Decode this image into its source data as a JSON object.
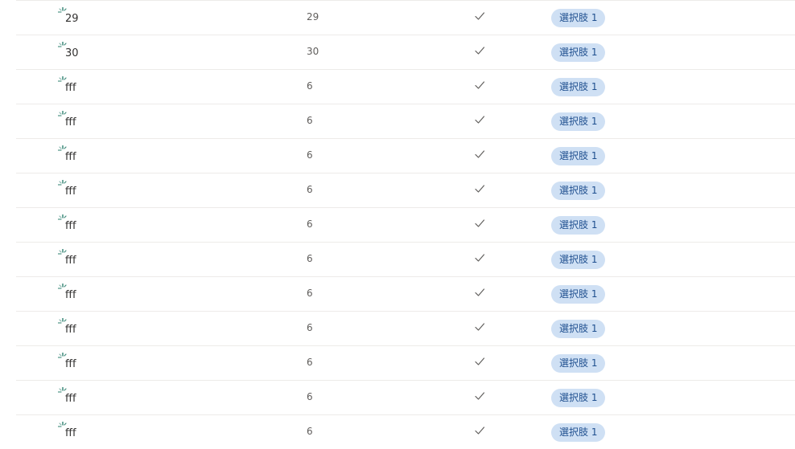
{
  "rows": [
    {
      "title": "29",
      "number": "29",
      "check": "checkmark",
      "choice": "選択肢 1"
    },
    {
      "title": "30",
      "number": "30",
      "check": "checkmark",
      "choice": "選択肢 1"
    },
    {
      "title": "fff",
      "number": "6",
      "check": "checkmark",
      "choice": "選択肢 1"
    },
    {
      "title": "fff",
      "number": "6",
      "check": "checkmark",
      "choice": "選択肢 1"
    },
    {
      "title": "fff",
      "number": "6",
      "check": "checkmark",
      "choice": "選択肢 1"
    },
    {
      "title": "fff",
      "number": "6",
      "check": "checkmark",
      "choice": "選択肢 1"
    },
    {
      "title": "fff",
      "number": "6",
      "check": "checkmark",
      "choice": "選択肢 1"
    },
    {
      "title": "fff",
      "number": "6",
      "check": "checkmark",
      "choice": "選択肢 1"
    },
    {
      "title": "fff",
      "number": "6",
      "check": "checkmark",
      "choice": "選択肢 1"
    },
    {
      "title": "fff",
      "number": "6",
      "check": "checkmark",
      "choice": "選択肢 1"
    },
    {
      "title": "fff",
      "number": "6",
      "check": "checkmark",
      "choice": "選択肢 1"
    },
    {
      "title": "fff",
      "number": "6",
      "check": "checkmark",
      "choice": "選択肢 1"
    },
    {
      "title": "fff",
      "number": "6",
      "check": "checkmark",
      "choice": "選択肢 1"
    }
  ],
  "colors": {
    "divider": "#edebe9",
    "pill_bg": "#cfe0f4",
    "pill_text": "#1f4f8f",
    "spinner": "#0f6e5a"
  },
  "icons": {
    "loading": "loading-spinner-icon",
    "check": "checkmark-icon"
  }
}
